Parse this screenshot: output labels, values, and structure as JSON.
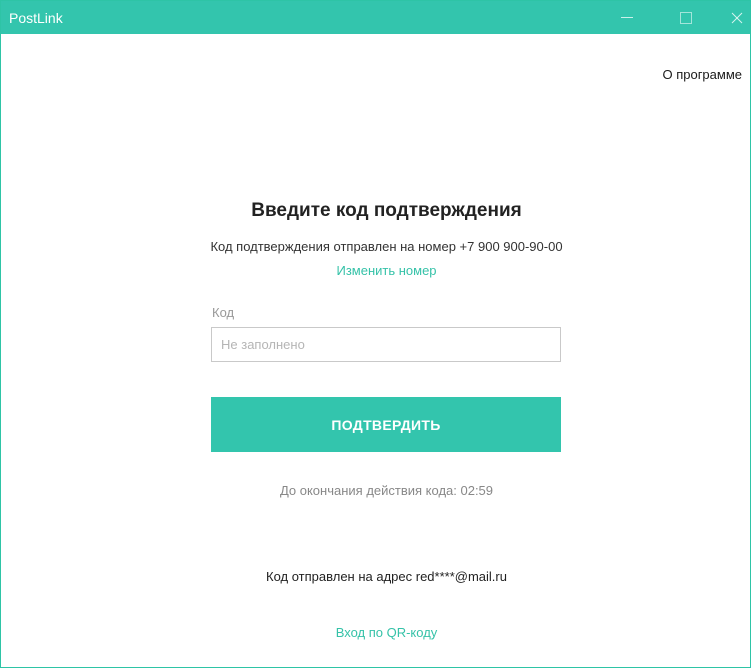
{
  "window": {
    "title": "PostLink",
    "accent_color": "#33c5ad",
    "controls": [
      "minimize-icon",
      "maximize-icon",
      "close-icon"
    ]
  },
  "header": {
    "about_label": "О программе"
  },
  "main": {
    "heading": "Введите код подтверждения",
    "sent_text": "Код подтверждения отправлен на номер +7  900 900-90-00",
    "change_number_label": "Изменить номер",
    "code_field": {
      "label": "Код",
      "placeholder": "Не заполнено",
      "value": ""
    },
    "confirm_button_label": "ПОДТВЕРДИТЬ",
    "timer_text": "До окончания действия кода: ",
    "timer_value": "02:59",
    "email_sent_text": "Код отправлен на адрес red****@mail.ru",
    "qr_login_label": "Вход по QR-коду"
  }
}
